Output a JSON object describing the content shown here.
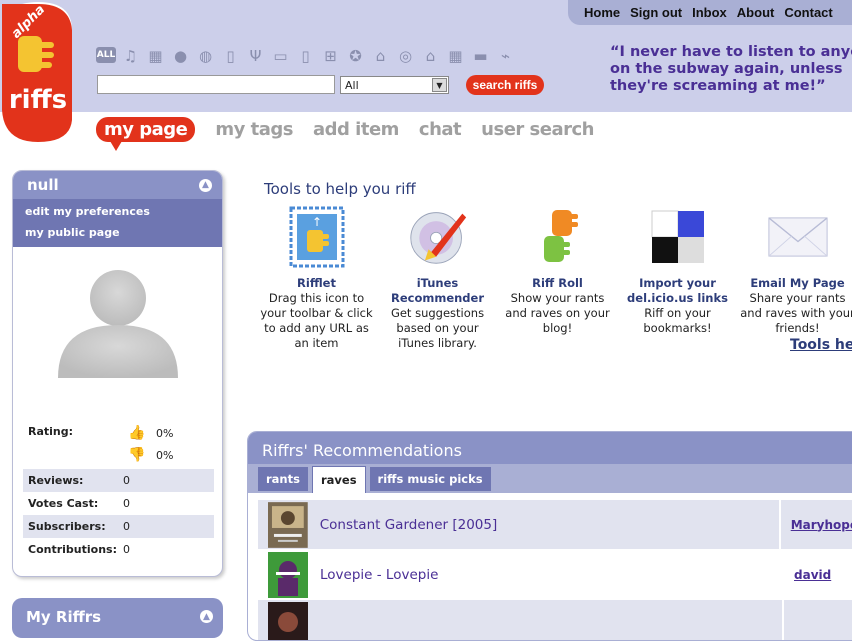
{
  "top_nav": [
    "Home",
    "Sign out",
    "Inbox",
    "About",
    "Contact"
  ],
  "logo": {
    "badge": "alpha",
    "name": "riffs"
  },
  "categories": [
    "ALL",
    "music",
    "film",
    "people",
    "world",
    "gadgets",
    "food-drink",
    "tv",
    "books",
    "games",
    "sports",
    "fashion",
    "music-cd",
    "home",
    "events",
    "cars",
    "tech"
  ],
  "search": {
    "value": "",
    "select_value": "All",
    "button": "search riffs"
  },
  "quote": [
    "“I never have to listen to anyone",
    "on the subway again, unless",
    "they're screaming at me!”"
  ],
  "tabs": [
    "my page",
    "my tags",
    "add item",
    "chat",
    "user search"
  ],
  "sidebar": {
    "username": "null",
    "links": [
      "edit my preferences",
      "my public page"
    ],
    "rating_label": "Rating:",
    "rating_up": "0%",
    "rating_down": "0%",
    "stats": [
      {
        "label": "Reviews:",
        "value": "0"
      },
      {
        "label": "Votes Cast:",
        "value": "0"
      },
      {
        "label": "Subscribers:",
        "value": "0"
      },
      {
        "label": "Contributions:",
        "value": "0"
      }
    ],
    "second_box_title": "My Riffrs"
  },
  "tools": {
    "title": "Tools to help you riff",
    "help_link": "Tools help",
    "items": [
      {
        "name": "Rifflet",
        "desc": "Drag this icon to your toolbar & click to add any URL as an item"
      },
      {
        "name": "iTunes Recommender",
        "desc": "Get suggestions based on your iTunes library."
      },
      {
        "name": "Riff Roll",
        "desc": "Show your rants and raves on your blog!"
      },
      {
        "name": "Import your del.icio.us links",
        "desc": "Riff on your bookmarks!"
      },
      {
        "name": "Email My Page",
        "desc": "Share your rants and raves with your friends!"
      }
    ]
  },
  "recommendations": {
    "title": "Riffrs' Recommendations",
    "tabs": [
      "rants",
      "raves",
      "riffs music picks"
    ],
    "active_tab": "raves",
    "items": [
      {
        "title": "Constant Gardener [2005]",
        "user": "Maryhope"
      },
      {
        "title": "Lovepie - Lovepie",
        "user": "david"
      },
      {
        "title": "",
        "user": ""
      }
    ]
  }
}
